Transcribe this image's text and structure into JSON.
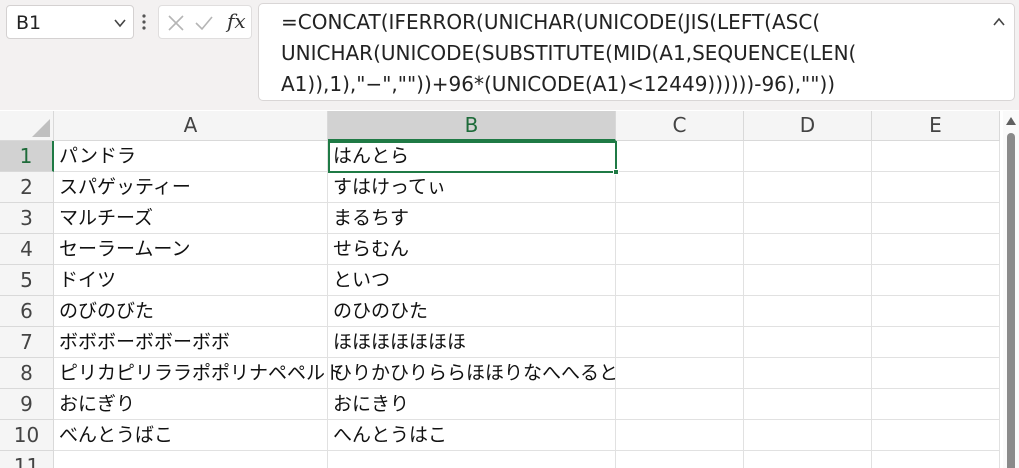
{
  "name_box": {
    "value": "B1"
  },
  "formula_bar": {
    "fx_label": "fx",
    "formula_lines": [
      "=CONCAT(IFERROR(UNICHAR(UNICODE(JIS(LEFT(ASC(",
      "UNICHAR(UNICODE(SUBSTITUTE(MID(A1,SEQUENCE(LEN(",
      "A1)),1),\"−\",\"\"))+96*(UNICODE(A1)<12449))))))-96),\"\"))"
    ]
  },
  "columns": [
    "A",
    "B",
    "C",
    "D",
    "E"
  ],
  "selected_column": "B",
  "rows": [
    {
      "num": "1",
      "a": "パンドラ",
      "b": "はんとら"
    },
    {
      "num": "2",
      "a": "スパゲッティー",
      "b": "すはけってぃ"
    },
    {
      "num": "3",
      "a": "マルチーズ",
      "b": "まるちす"
    },
    {
      "num": "4",
      "a": "セーラームーン",
      "b": "せらむん"
    },
    {
      "num": "5",
      "a": "ドイツ",
      "b": "といつ"
    },
    {
      "num": "6",
      "a": "のびのびた",
      "b": "のひのひた"
    },
    {
      "num": "7",
      "a": "ボボボーボボーボボ",
      "b": "ほほほほほほほ"
    },
    {
      "num": "8",
      "a": "ピリカピリララポポリナペペルト",
      "b": "ひりかひりららほほりなへへると"
    },
    {
      "num": "9",
      "a": "おにぎり",
      "b": "おにきり"
    },
    {
      "num": "10",
      "a": "べんとうばこ",
      "b": "へんとうはこ"
    },
    {
      "num": "11",
      "a": "",
      "b": ""
    }
  ],
  "selected_row": "1",
  "colors": {
    "accent": "#1f7a45",
    "header_bg": "#f5f5f5",
    "selected_header_bg": "#d2d2d2",
    "toolbar_bg": "#f3f1f1"
  },
  "icons": [
    "chevron-down-icon",
    "more-options-icon",
    "cancel-x-icon",
    "confirm-check-icon",
    "insert-function-icon",
    "collapse-formula-bar-icon",
    "select-all-icon",
    "scroll-up-icon"
  ]
}
